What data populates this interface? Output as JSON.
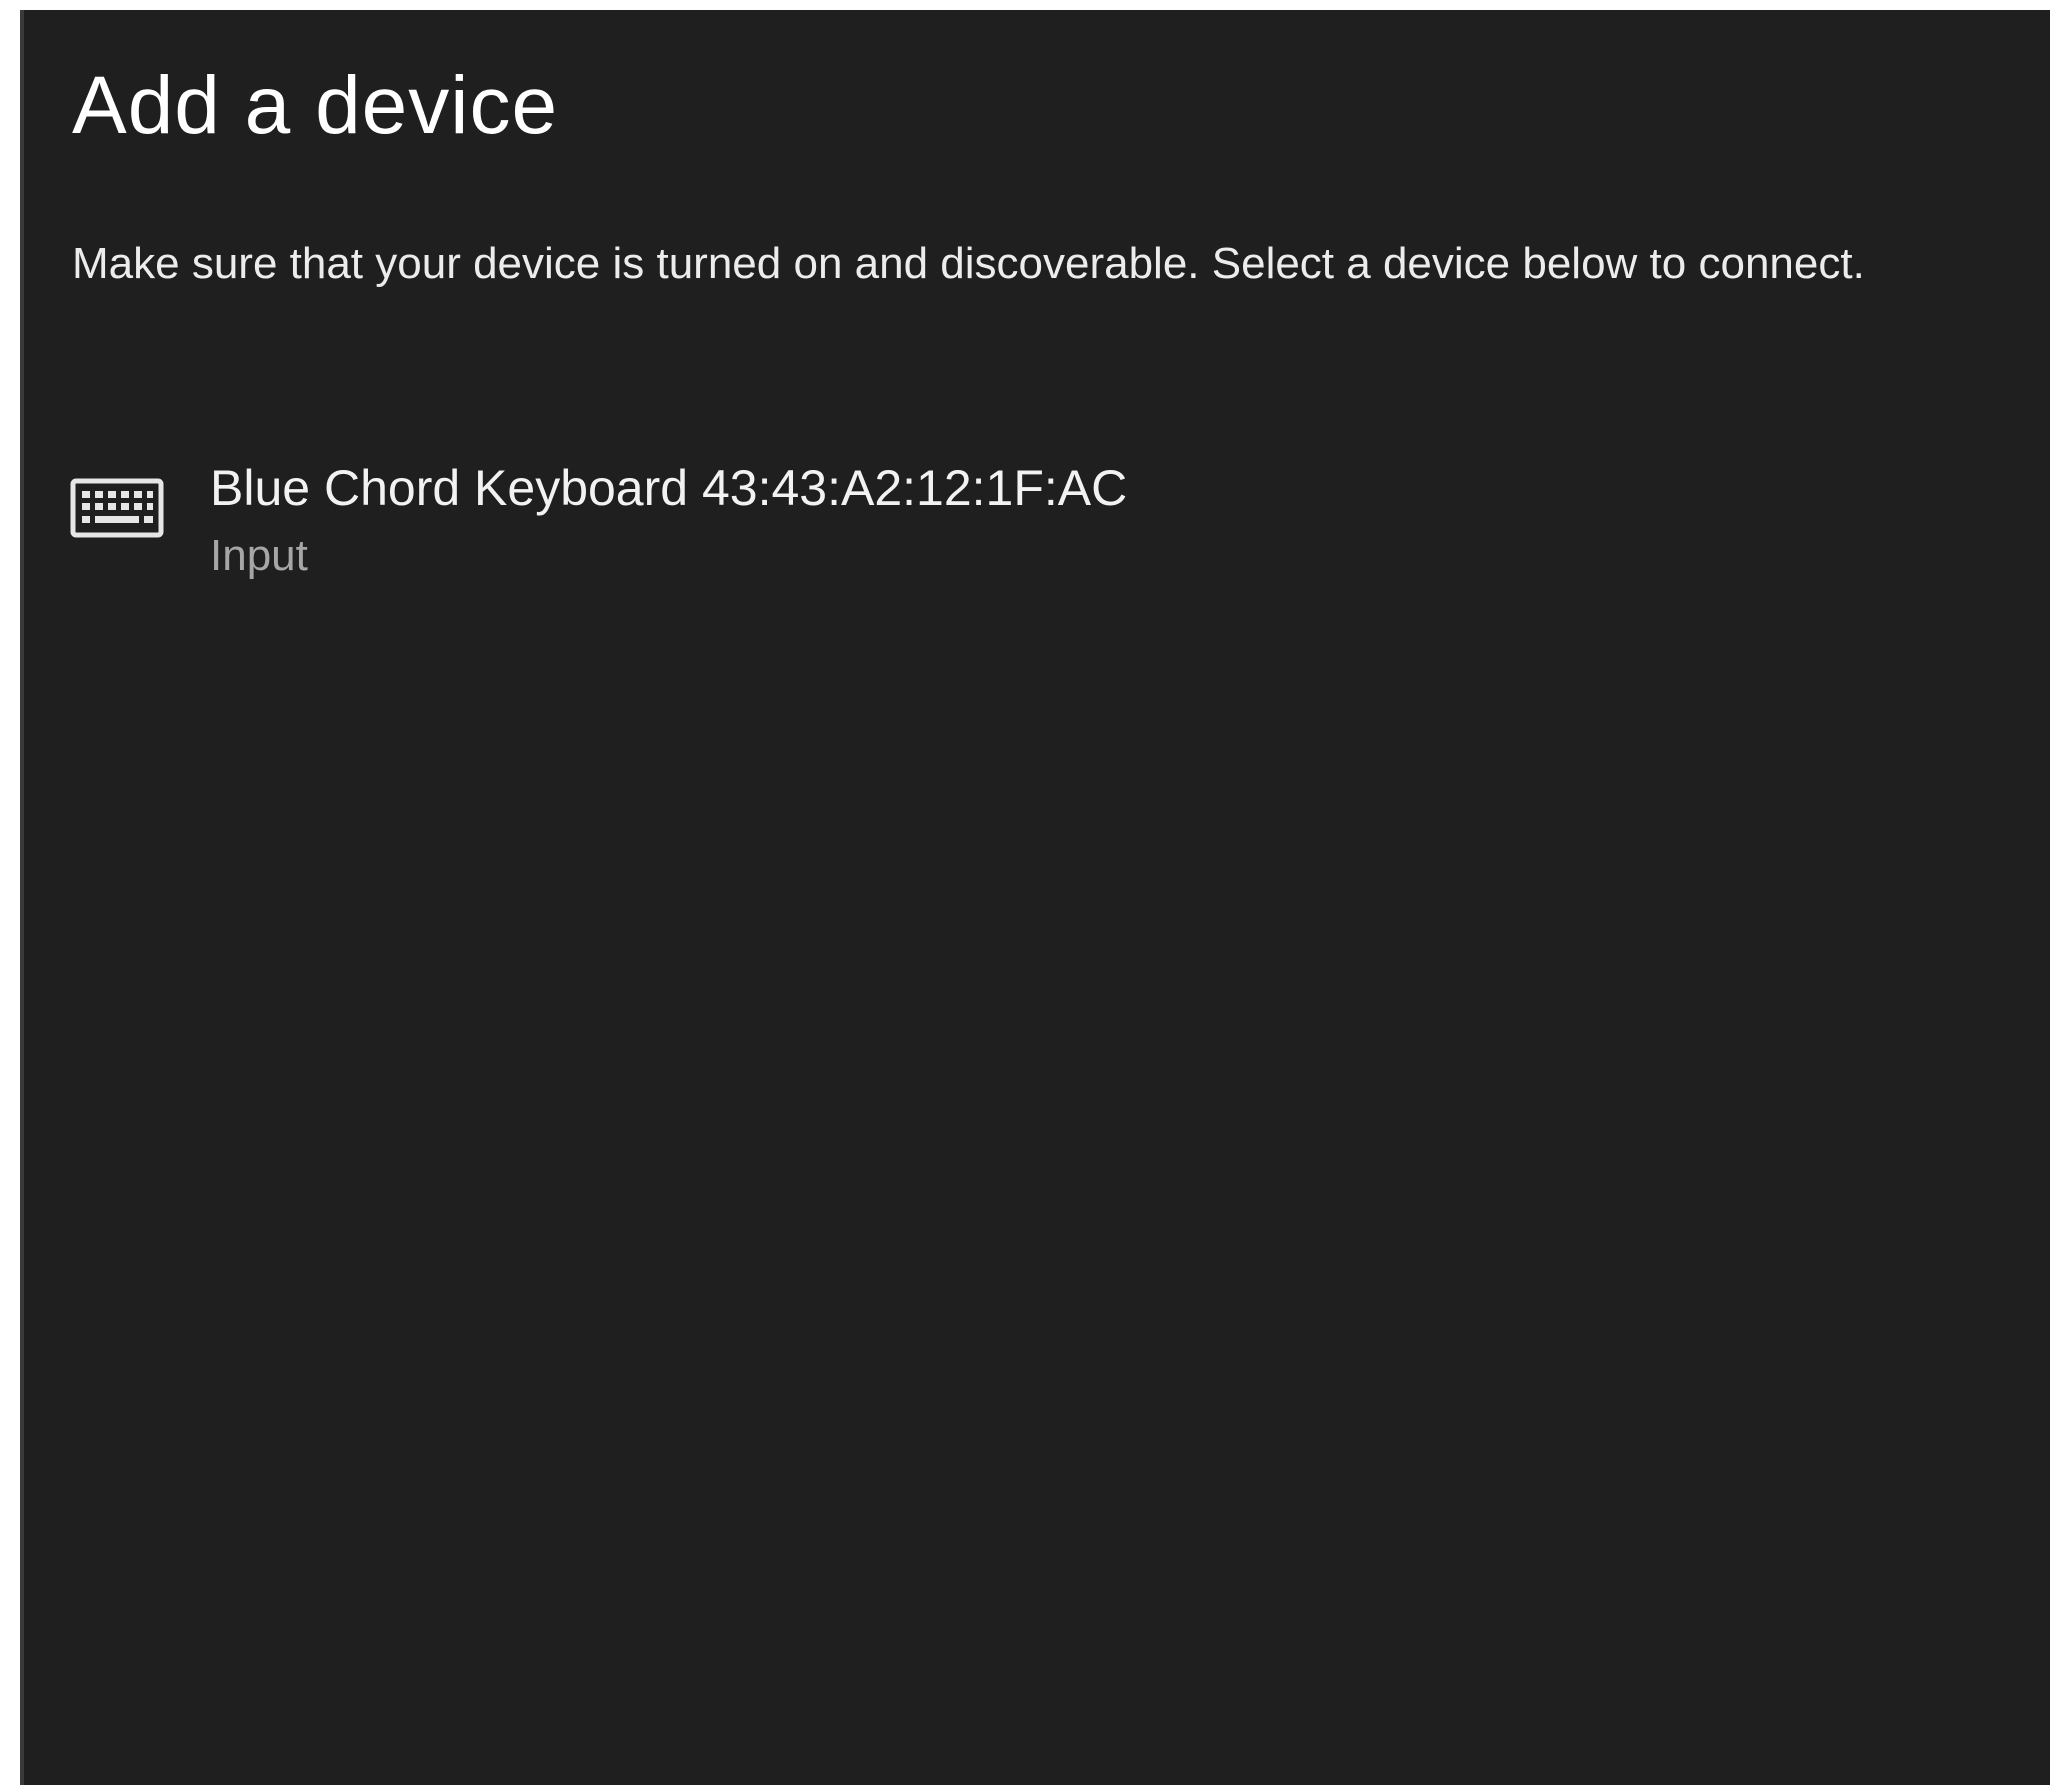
{
  "dialog": {
    "title": "Add a device",
    "instructions": "Make sure that your device is turned on and discoverable. Select a device below to connect."
  },
  "devices": [
    {
      "name": "Blue Chord Keyboard 43:43:A2:12:1F:AC",
      "type": "Input",
      "icon": "keyboard-icon"
    }
  ],
  "colors": {
    "background": "#1f1f1f",
    "title_text": "#ffffff",
    "body_text": "#ececec",
    "secondary_text": "#a6a6a6"
  }
}
